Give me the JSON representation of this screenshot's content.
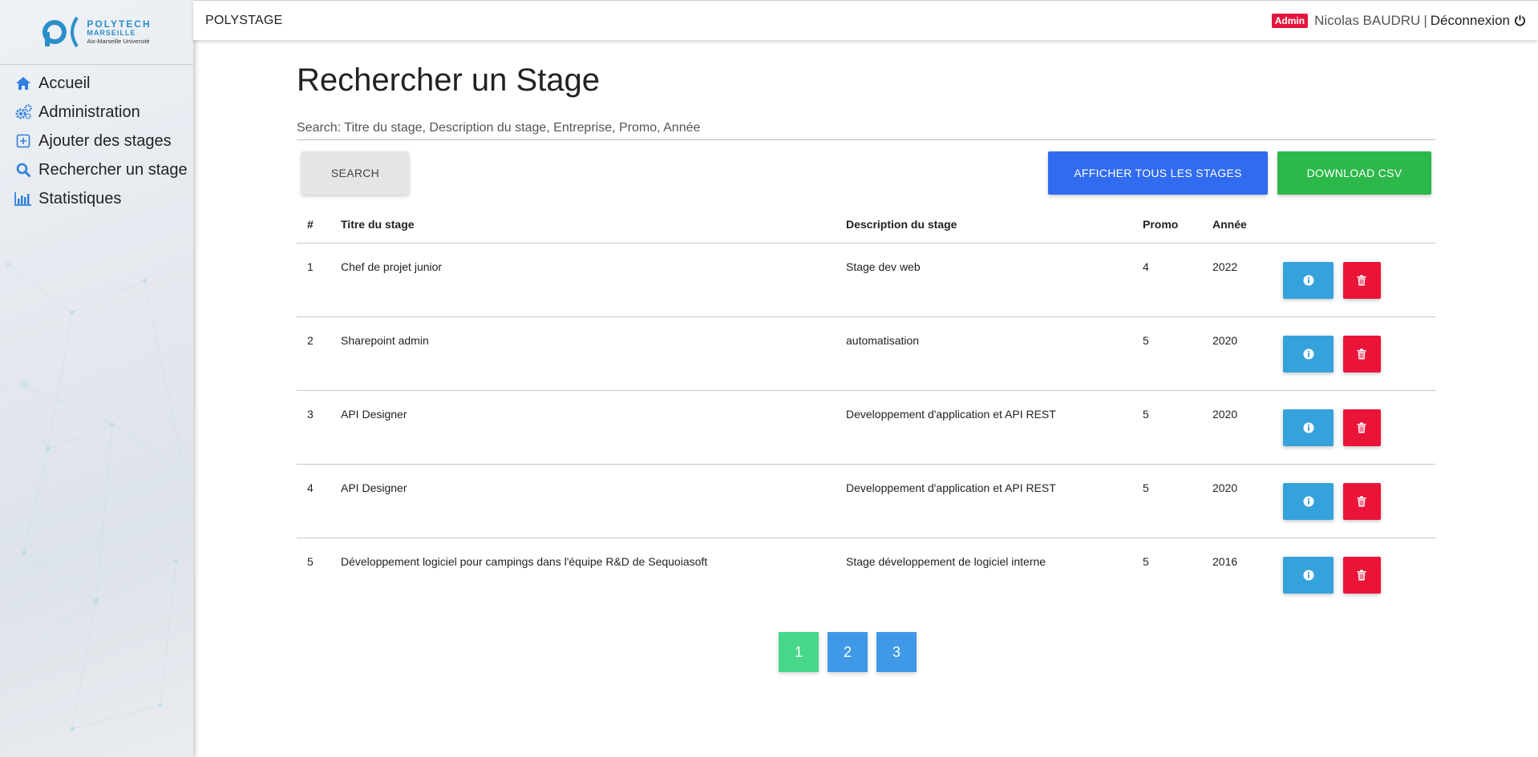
{
  "app": {
    "brand": "POLYSTAGE"
  },
  "logo": {
    "line1": "POLYTECH",
    "line2": "MARSEILLE",
    "line3": "Aix-Marseille Université"
  },
  "sidebar": {
    "items": [
      {
        "label": "Accueil",
        "icon": "home-icon"
      },
      {
        "label": "Administration",
        "icon": "gears-icon"
      },
      {
        "label": "Ajouter des stages",
        "icon": "plus-square-icon"
      },
      {
        "label": "Rechercher un stage",
        "icon": "search-icon"
      },
      {
        "label": "Statistiques",
        "icon": "bar-chart-icon"
      }
    ]
  },
  "header": {
    "role_badge": "Admin",
    "user_name": "Nicolas BAUDRU",
    "separator": "|",
    "logout_label": "Déconnexion"
  },
  "main": {
    "title": "Rechercher un Stage",
    "search_placeholder": "Search: Titre du stage, Description du stage, Entreprise, Promo, Année",
    "search_button": "SEARCH",
    "show_all_button": "AFFICHER TOUS LES STAGES",
    "download_button": "DOWNLOAD CSV"
  },
  "table": {
    "columns": [
      "#",
      "Titre du stage",
      "Description du stage",
      "Promo",
      "Année",
      ""
    ],
    "rows": [
      {
        "num": "1",
        "title": "Chef de projet junior",
        "description": "Stage dev web",
        "promo": "4",
        "year": "2022"
      },
      {
        "num": "2",
        "title": "Sharepoint admin",
        "description": "automatisation",
        "promo": "5",
        "year": "2020"
      },
      {
        "num": "3",
        "title": "API Designer",
        "description": "Developpement d'application et API REST",
        "promo": "5",
        "year": "2020"
      },
      {
        "num": "4",
        "title": "API Designer",
        "description": "Developpement d'application et API REST",
        "promo": "5",
        "year": "2020"
      },
      {
        "num": "5",
        "title": "Développement logiciel pour campings dans l'équipe R&D de Sequoiasoft",
        "description": "Stage développement de logiciel interne",
        "promo": "5",
        "year": "2016"
      }
    ]
  },
  "pagination": {
    "pages": [
      "1",
      "2",
      "3"
    ],
    "current": "1"
  },
  "colors": {
    "accent_blue": "#316bf0",
    "csv_green": "#2db84b",
    "info_blue": "#35a2dc",
    "delete_red": "#ea1439",
    "page_active": "#46d789",
    "page_normal": "#3f99e7",
    "badge_red": "#e3163d"
  }
}
